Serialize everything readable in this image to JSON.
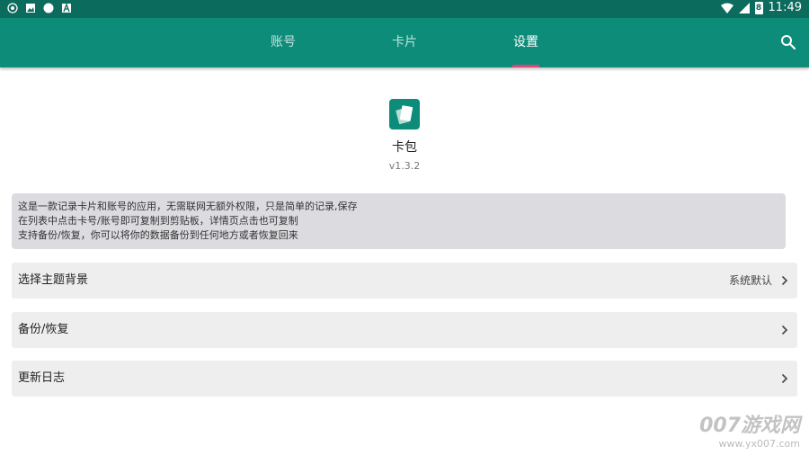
{
  "status_bar": {
    "time": "11:49",
    "battery_label": "8"
  },
  "tabs": [
    {
      "label": "账号",
      "active": false
    },
    {
      "label": "卡片",
      "active": false
    },
    {
      "label": "设置",
      "active": true
    }
  ],
  "colors": {
    "appbar": "#0d8c7a",
    "statusbar": "#0b6b5d",
    "indicator": "#e0457b"
  },
  "about": {
    "app_name": "卡包",
    "version": "v1.3.2",
    "logo_icon": "cards-icon"
  },
  "description": [
    "这是一款记录卡片和账号的应用，无需联网无额外权限，只是简单的记录,保存",
    "在列表中点击卡号/账号即可复制到剪贴板，详情页点击也可复制",
    "支持备份/恢复，你可以将你的数据备份到任何地方或者恢复回来"
  ],
  "settings": [
    {
      "label": "选择主题背景",
      "value": "系统默认"
    },
    {
      "label": "备份/恢复",
      "value": ""
    },
    {
      "label": "更新日志",
      "value": ""
    }
  ],
  "watermark": {
    "brand": "007游戏网",
    "url": "www.yx007.com"
  }
}
